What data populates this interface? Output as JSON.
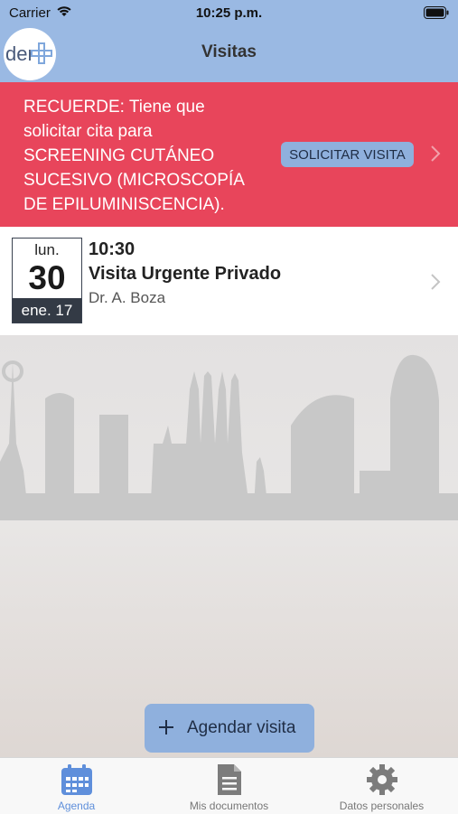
{
  "status_bar": {
    "carrier": "Carrier",
    "time": "10:25 p.m."
  },
  "app": {
    "logo_text": "der",
    "title": "Visitas"
  },
  "banner": {
    "message": " RECUERDE: Tiene que\nsolicitar cita para\nSCREENING CUTÁNEO\nSUCESIVO (MICROSCOPÍA\nDE EPILUMINISCENCIA).",
    "button_label": "SOLICITAR VISITA",
    "color": "#e8455b"
  },
  "visit": {
    "day_of_week": "lun.",
    "day": "30",
    "month_year": "ene. 17",
    "time": "10:30",
    "title": "Visita Urgente Privado",
    "doctor": "Dr. A. Boza"
  },
  "actions": {
    "agendar_label": "Agendar visita"
  },
  "tabs": [
    {
      "label": "Agenda",
      "icon": "calendar-icon",
      "active": true
    },
    {
      "label": "Mis documentos",
      "icon": "document-icon",
      "active": false
    },
    {
      "label": "Datos personales",
      "icon": "gear-icon",
      "active": false
    }
  ],
  "colors": {
    "header": "#9ab9e3",
    "accent": "#5f8fdb",
    "button": "#8fb0dd"
  }
}
